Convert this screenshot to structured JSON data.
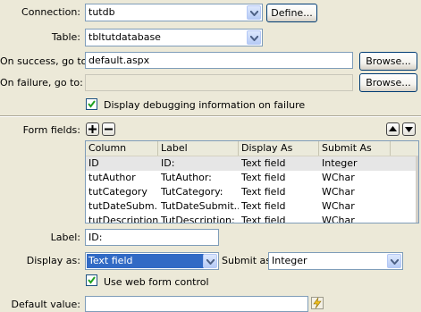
{
  "connection": {
    "label": "Connection:",
    "value": "tutdb",
    "define_label": "Define..."
  },
  "table": {
    "label": "Table:",
    "value": "tbltutdatabase"
  },
  "on_success": {
    "label": "On success, go to:",
    "value": "default.aspx",
    "browse_label": "Browse..."
  },
  "on_failure": {
    "label": "On failure, go to:",
    "value": "",
    "browse_label": "Browse..."
  },
  "debug": {
    "label": "Display debugging information on failure",
    "checked": true
  },
  "form_fields": {
    "label": "Form fields:",
    "columns": [
      "Column",
      "Label",
      "Display As",
      "Submit As"
    ],
    "rows": [
      [
        "ID",
        "ID:",
        "Text field",
        "Integer"
      ],
      [
        "tutAuthor",
        "TutAuthor:",
        "Text field",
        "WChar"
      ],
      [
        "tutCategory",
        "TutCategory:",
        "Text field",
        "WChar"
      ],
      [
        "tutDateSubm...",
        "TutDateSubmit...",
        "Text field",
        "WChar"
      ],
      [
        "tutDescription",
        "TutDescription:",
        "Text field",
        "WChar"
      ]
    ]
  },
  "label_field": {
    "label": "Label:",
    "value": "ID:"
  },
  "display_as": {
    "label": "Display as:",
    "value": "Text field"
  },
  "submit_as": {
    "label": "Submit as:",
    "value": "Integer"
  },
  "web_form_control": {
    "label": "Use web form control",
    "checked": true
  },
  "default_value": {
    "label": "Default value:",
    "value": ""
  },
  "icons": {
    "add": "plus-icon",
    "remove": "minus-icon",
    "up": "arrow-up-icon",
    "down": "arrow-down-icon",
    "dynamic": "lightning-icon"
  }
}
